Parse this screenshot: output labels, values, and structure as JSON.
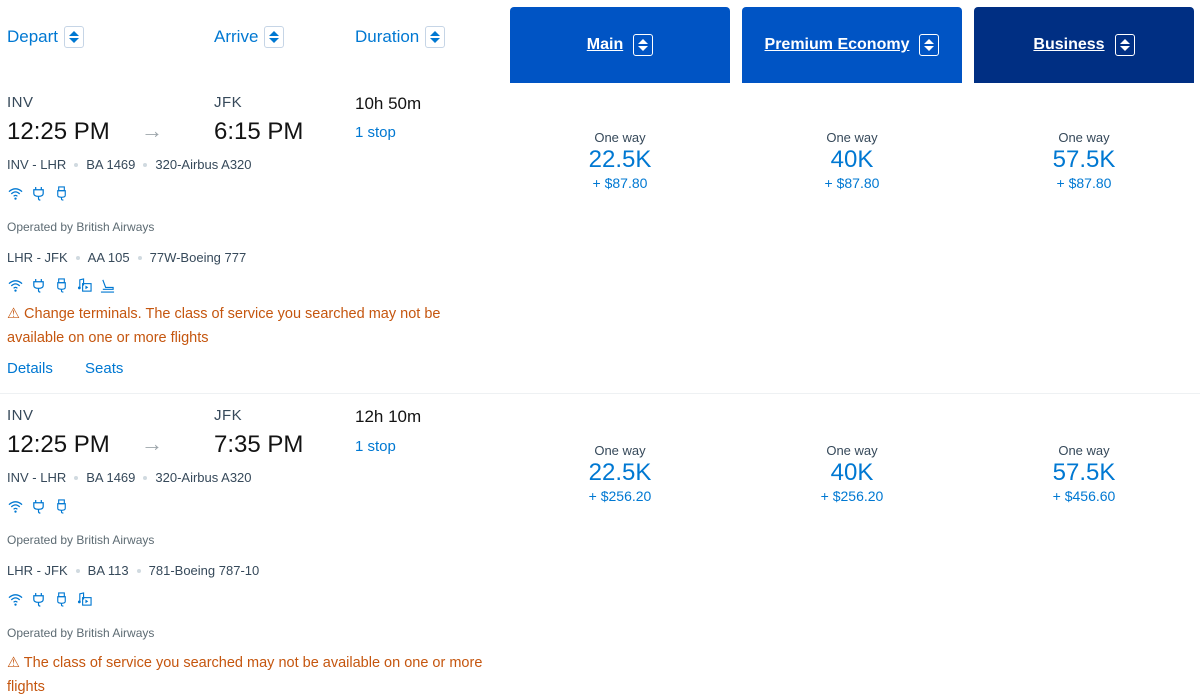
{
  "sort_headers": {
    "depart": "Depart",
    "arrive": "Arrive",
    "duration": "Duration"
  },
  "cabins": [
    {
      "label": "Main",
      "color": "#0054c4"
    },
    {
      "label": "Premium Economy",
      "color": "#0054c4"
    },
    {
      "label": "Business",
      "color": "#002f83"
    }
  ],
  "flights": [
    {
      "origin": "INV",
      "destination": "JFK",
      "depart_time": "12:25 PM",
      "arrive_time": "6:15 PM",
      "duration": "10h 50m",
      "stops": "1 stop",
      "segments": [
        {
          "route": "INV - LHR",
          "flight": "BA 1469",
          "aircraft": "320-Airbus A320",
          "amenities": [
            "wifi-icon",
            "power-outlet-icon",
            "usb-icon"
          ],
          "operated_by": "Operated by British Airways"
        },
        {
          "route": "LHR - JFK",
          "flight": "AA 105",
          "aircraft": "77W-Boeing 777",
          "amenities": [
            "wifi-icon",
            "power-outlet-icon",
            "usb-icon",
            "entertainment-icon",
            "lie-flat-seat-icon"
          ]
        }
      ],
      "warning": "Change terminals. The class of service you searched may not be available on one or more flights",
      "links": {
        "details": "Details",
        "seats": "Seats"
      },
      "fares": [
        {
          "label": "One way",
          "miles": "22.5K",
          "tax": "+ $87.80"
        },
        {
          "label": "One way",
          "miles": "40K",
          "tax": "+ $87.80"
        },
        {
          "label": "One way",
          "miles": "57.5K",
          "tax": "+ $87.80"
        }
      ]
    },
    {
      "origin": "INV",
      "destination": "JFK",
      "depart_time": "12:25 PM",
      "arrive_time": "7:35 PM",
      "duration": "12h 10m",
      "stops": "1 stop",
      "segments": [
        {
          "route": "INV - LHR",
          "flight": "BA 1469",
          "aircraft": "320-Airbus A320",
          "amenities": [
            "wifi-icon",
            "power-outlet-icon",
            "usb-icon"
          ],
          "operated_by": "Operated by British Airways"
        },
        {
          "route": "LHR - JFK",
          "flight": "BA 113",
          "aircraft": "781-Boeing 787-10",
          "amenities": [
            "wifi-icon",
            "power-outlet-icon",
            "usb-icon",
            "entertainment-icon"
          ],
          "operated_by": "Operated by British Airways"
        }
      ],
      "warning": "The class of service you searched may not be available on one or more flights",
      "fares": [
        {
          "label": "One way",
          "miles": "22.5K",
          "tax": "+ $256.20"
        },
        {
          "label": "One way",
          "miles": "40K",
          "tax": "+ $256.20"
        },
        {
          "label": "One way",
          "miles": "57.5K",
          "tax": "+ $456.60"
        }
      ]
    }
  ],
  "warning_icon": "warning-triangle-icon"
}
